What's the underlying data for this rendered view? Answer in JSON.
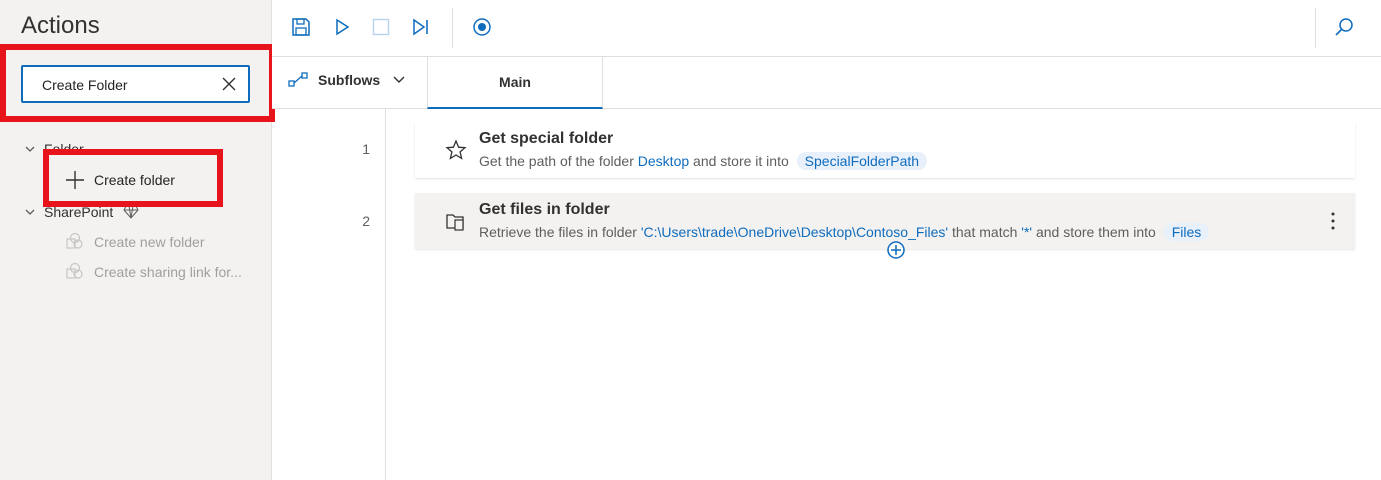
{
  "actions_pane": {
    "title": "Actions",
    "search": {
      "value": "Create Folder"
    },
    "groups": [
      {
        "label": "Folder",
        "items": [
          {
            "label": "Create folder",
            "enabled": true
          }
        ]
      },
      {
        "label": "SharePoint",
        "items": [
          {
            "label": "Create new folder",
            "enabled": false
          },
          {
            "label": "Create sharing link for...",
            "enabled": false
          }
        ]
      }
    ]
  },
  "toolbar": {
    "buttons": [
      "save-icon",
      "run-icon",
      "stop-icon",
      "run-next-action-icon",
      "record-icon",
      "search-icon"
    ]
  },
  "tabs": {
    "subflows_label": "Subflows",
    "main_label": "Main"
  },
  "steps": [
    {
      "number": "1",
      "icon": "star-icon",
      "title": "Get special folder",
      "desc_prefix": "Get the path of the folder ",
      "folder": "Desktop",
      "desc_mid": " and store it into ",
      "variable": "SpecialFolderPath"
    },
    {
      "number": "2",
      "icon": "folder-files-icon",
      "title": "Get files in folder",
      "desc_prefix": "Retrieve the files in folder ",
      "path": "'C:\\Users\\trade\\OneDrive\\Desktop\\Contoso_Files'",
      "desc_mid": " that match ",
      "pattern": "'*'",
      "desc_suffix": " and store them into ",
      "variable": "Files"
    }
  ],
  "colors": {
    "accent": "#0f6cbd",
    "highlight": "#e8141c",
    "pane_bg": "#f3f2f1"
  }
}
